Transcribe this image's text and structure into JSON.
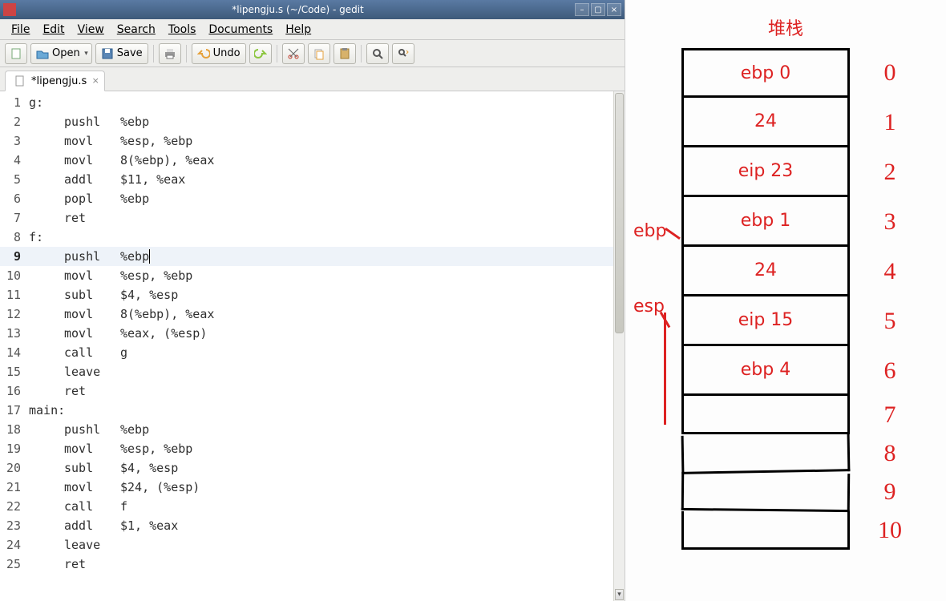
{
  "window": {
    "title": "*lipengju.s (~/Code) - gedit"
  },
  "menu": {
    "file": "File",
    "edit": "Edit",
    "view": "View",
    "search": "Search",
    "tools": "Tools",
    "documents": "Documents",
    "help": "Help"
  },
  "toolbar": {
    "open": "Open",
    "save": "Save",
    "undo": "Undo"
  },
  "tab": {
    "filename": "*lipengju.s"
  },
  "code": {
    "current_line": 9,
    "lines": [
      {
        "n": 1,
        "indent": "",
        "mnemonic": "g:",
        "ops": ""
      },
      {
        "n": 2,
        "indent": "  ",
        "mnemonic": "pushl",
        "ops": "%ebp"
      },
      {
        "n": 3,
        "indent": "  ",
        "mnemonic": "movl",
        "ops": "%esp, %ebp"
      },
      {
        "n": 4,
        "indent": "  ",
        "mnemonic": "movl",
        "ops": "8(%ebp), %eax"
      },
      {
        "n": 5,
        "indent": "  ",
        "mnemonic": "addl",
        "ops": "$11, %eax"
      },
      {
        "n": 6,
        "indent": "  ",
        "mnemonic": "popl",
        "ops": "%ebp"
      },
      {
        "n": 7,
        "indent": "  ",
        "mnemonic": "ret",
        "ops": ""
      },
      {
        "n": 8,
        "indent": "",
        "mnemonic": "f:",
        "ops": ""
      },
      {
        "n": 9,
        "indent": "  ",
        "mnemonic": "pushl",
        "ops": "%ebp"
      },
      {
        "n": 10,
        "indent": "  ",
        "mnemonic": "movl",
        "ops": "%esp, %ebp"
      },
      {
        "n": 11,
        "indent": "  ",
        "mnemonic": "subl",
        "ops": "$4, %esp"
      },
      {
        "n": 12,
        "indent": "  ",
        "mnemonic": "movl",
        "ops": "8(%ebp), %eax"
      },
      {
        "n": 13,
        "indent": "  ",
        "mnemonic": "movl",
        "ops": "%eax, (%esp)"
      },
      {
        "n": 14,
        "indent": "  ",
        "mnemonic": "call",
        "ops": "g"
      },
      {
        "n": 15,
        "indent": "  ",
        "mnemonic": "leave",
        "ops": ""
      },
      {
        "n": 16,
        "indent": "  ",
        "mnemonic": "ret",
        "ops": ""
      },
      {
        "n": 17,
        "indent": "",
        "mnemonic": "main:",
        "ops": ""
      },
      {
        "n": 18,
        "indent": "  ",
        "mnemonic": "pushl",
        "ops": "%ebp"
      },
      {
        "n": 19,
        "indent": "  ",
        "mnemonic": "movl",
        "ops": "%esp, %ebp"
      },
      {
        "n": 20,
        "indent": "  ",
        "mnemonic": "subl",
        "ops": "$4, %esp"
      },
      {
        "n": 21,
        "indent": "  ",
        "mnemonic": "movl",
        "ops": "$24, (%esp)"
      },
      {
        "n": 22,
        "indent": "  ",
        "mnemonic": "call",
        "ops": "f"
      },
      {
        "n": 23,
        "indent": "  ",
        "mnemonic": "addl",
        "ops": "$1, %eax"
      },
      {
        "n": 24,
        "indent": "  ",
        "mnemonic": "leave",
        "ops": ""
      },
      {
        "n": 25,
        "indent": "  ",
        "mnemonic": "ret",
        "ops": ""
      }
    ]
  },
  "sketch": {
    "title": "堆栈",
    "rows": [
      "ebp 0",
      "24",
      "eip 23",
      "ebp 1",
      "24",
      "eip 15",
      "ebp 4",
      "",
      "",
      "",
      ""
    ],
    "indices": [
      "0",
      "1",
      "2",
      "3",
      "4",
      "5",
      "6",
      "7",
      "8",
      "9",
      "10"
    ],
    "pointers": {
      "ebp": "ebp",
      "esp": "esp"
    }
  }
}
